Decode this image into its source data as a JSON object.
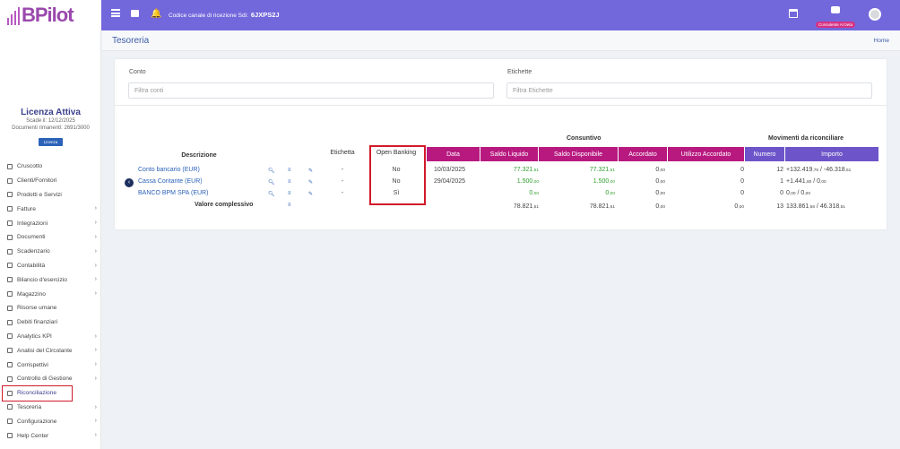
{
  "brand": {
    "logo_text": "BPilot",
    "accent": "#7367dc",
    "logo_color": "#9b49ad"
  },
  "topbar": {
    "codice_label": "Codice canale di ricezione Sdi:",
    "codice_value": "6JXPS2J",
    "consulente_label": "Consulente AI beta"
  },
  "license": {
    "title": "Licenza Attiva",
    "scade": "Scade il: 12/12/2025",
    "documenti": "Documenti rimanenti: 2691/3000",
    "button": "Licenza"
  },
  "nav": [
    {
      "label": "Cruscotto",
      "chevron": false
    },
    {
      "label": "Clienti/Fornitori",
      "chevron": false
    },
    {
      "label": "Prodotti e Servizi",
      "chevron": false
    },
    {
      "label": "Fatture",
      "chevron": true
    },
    {
      "label": "Integrazioni",
      "chevron": true
    },
    {
      "label": "Documenti",
      "chevron": true
    },
    {
      "label": "Scadenzario",
      "chevron": true
    },
    {
      "label": "Contabilità",
      "chevron": true
    },
    {
      "label": "Bilancio d'esercizio",
      "chevron": true
    },
    {
      "label": "Magazzino",
      "chevron": true
    },
    {
      "label": "Risorse umane",
      "chevron": false
    },
    {
      "label": "Debiti finanziari",
      "chevron": false
    },
    {
      "label": "Analytics KPI",
      "chevron": true
    },
    {
      "label": "Analisi del Circolante",
      "chevron": true
    },
    {
      "label": "Corrispettivi",
      "chevron": true
    },
    {
      "label": "Controllo di Gestione",
      "chevron": true
    },
    {
      "label": "Riconciliazione",
      "chevron": false,
      "active": true
    },
    {
      "label": "Tesoreria",
      "chevron": true
    },
    {
      "label": "Configurazione",
      "chevron": true
    },
    {
      "label": "Help Center",
      "chevron": true
    }
  ],
  "page": {
    "title": "Tesoreria",
    "home": "Home"
  },
  "filters": {
    "conto_label": "Conto",
    "conto_placeholder": "Filtra conti",
    "etichette_label": "Etichette",
    "etichette_placeholder": "Filtra Etichette"
  },
  "table": {
    "group_consuntivo": "Consuntivo",
    "group_movimenti": "Movimenti da riconciliare",
    "headers": {
      "descrizione": "Descrizione",
      "etichetta": "Etichetta",
      "open_banking": "Open Banking",
      "data": "Data",
      "saldo_liquido": "Saldo Liquido",
      "saldo_disponibile": "Saldo Disponibile",
      "accordato": "Accordato",
      "utilizzo_accordato": "Utilizzo Accordato",
      "numero": "Numero",
      "importo": "Importo"
    },
    "rows": [
      {
        "desc": "Conto bancario (EUR)",
        "etichetta": "-",
        "ob": "No",
        "data": "10/03/2025",
        "sl": "77.321",
        "sl_dec": ",51",
        "sd": "77.321",
        "sd_dec": ",51",
        "acc": "0",
        "acc_dec": ",00",
        "util": "0",
        "num": "12",
        "imp_pos": "+132.419",
        "imp_pos_dec": ",76",
        "imp_neg": "-46.318",
        "imp_neg_dec": ",51"
      },
      {
        "desc": "Cassa Contante (EUR)",
        "etichetta": "-",
        "ob": "No",
        "data": "29/04/2025",
        "sl": "1.500",
        "sl_dec": ",00",
        "sd": "1.500",
        "sd_dec": ",00",
        "acc": "0",
        "acc_dec": ",00",
        "util": "0",
        "num": "1",
        "imp_pos": "+1.441",
        "imp_pos_dec": ",80",
        "imp_neg": "0",
        "imp_neg_dec": ",00"
      },
      {
        "desc": "BANCO BPM SPA (EUR)",
        "etichetta": "-",
        "ob": "Sì",
        "data": "",
        "sl": "0",
        "sl_dec": ",00",
        "sd": "0",
        "sd_dec": ",00",
        "acc": "0",
        "acc_dec": ",00",
        "util": "0",
        "num": "0",
        "imp_pos": "0",
        "imp_pos_dec": ",00",
        "imp_neg": "0",
        "imp_neg_dec": ",00"
      }
    ],
    "total": {
      "label": "Valore complessivo",
      "sl": "78.821",
      "sl_dec": ",51",
      "sd": "78.821",
      "sd_dec": ",51",
      "acc": "0",
      "acc_dec": ",00",
      "util": "0",
      "util_dec": ",00",
      "num": "13",
      "imp_pos": "133.861",
      "imp_pos_dec": ",56",
      "imp_neg": "46.318",
      "imp_neg_dec": ",51"
    }
  },
  "colors": {
    "header_magenta": "#b7197f",
    "header_purple": "#6d55c9",
    "highlight_red": "#d11a2a",
    "green": "#2e9e2e"
  }
}
